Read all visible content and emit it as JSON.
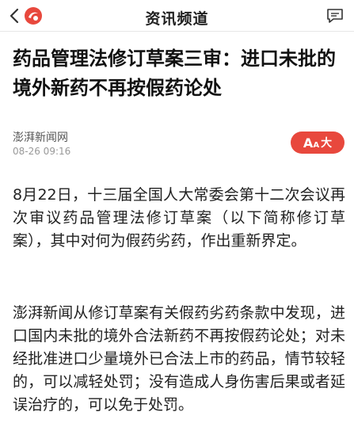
{
  "nav": {
    "title": "资讯频道",
    "back_icon": "chevron-left-icon",
    "logo_icon": "app-logo-icon",
    "message_icon": "chat-bubble-icon"
  },
  "article": {
    "headline": "药品管理法修订草案三审：进口未批的境外新药不再按假药论处",
    "source": "澎湃新闻网",
    "datetime": "08-26 09:16",
    "font_button": {
      "label_a": "A",
      "label_size": "大"
    },
    "paragraphs": [
      "8月22日，十三届全国人大常委会第十二次会议再次审议药品管理法修订草案（以下简称修订草案），其中对何为假药劣药，作出重新界定。",
      "澎湃新闻从修订草案有关假药劣药条款中发现，进口国内未批的境外合法新药不再按假药论处；对未经批准进口少量境外已合法上市的药品，情节较轻的，可以减轻处罚；没有造成人身伤害后果或者延误治疗的，可以免于处罚。"
    ]
  },
  "colors": {
    "accent": "#e8483d",
    "text": "#222222",
    "muted": "#999999"
  }
}
